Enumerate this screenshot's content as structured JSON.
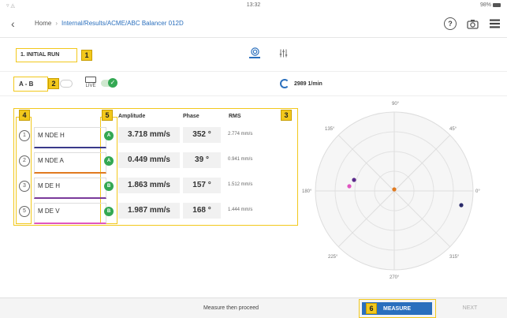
{
  "status": {
    "time": "13:32",
    "battery": "98%"
  },
  "header": {
    "crumb_home": "Home",
    "crumb_path": "Internal/Results/ACME/ABC Balancer 012D"
  },
  "run": {
    "title": "1. INITIAL RUN"
  },
  "plane": {
    "label": "A - B",
    "live": "LIVE"
  },
  "rpm": {
    "value": "2989 1/min"
  },
  "badges": [
    "1",
    "2",
    "3",
    "4",
    "5",
    "6"
  ],
  "table": {
    "headers": {
      "amplitude": "Amplitude",
      "phase": "Phase",
      "rms": "RMS"
    },
    "rows": [
      {
        "num": "1",
        "name": "M NDE H",
        "plane": "A",
        "amplitude": "3.718 mm/s",
        "phase": "352 °",
        "rms": "2.774 mm/s",
        "color": "#3a3a8a"
      },
      {
        "num": "2",
        "name": "M NDE A",
        "plane": "A",
        "amplitude": "0.449 mm/s",
        "phase": "39 °",
        "rms": "0.941 mm/s",
        "color": "#e07a20"
      },
      {
        "num": "3",
        "name": "M DE H",
        "plane": "B",
        "amplitude": "1.863 mm/s",
        "phase": "157 °",
        "rms": "1.512 mm/s",
        "color": "#7a3a9a"
      },
      {
        "num": "5",
        "name": "M DE V",
        "plane": "B",
        "amplitude": "1.987 mm/s",
        "phase": "168 °",
        "rms": "1.444 mm/s",
        "color": "#e055c0"
      }
    ]
  },
  "polar": {
    "angle_labels": [
      "90°",
      "45°",
      "0°",
      "315°",
      "270°",
      "225°",
      "180°",
      "135°"
    ]
  },
  "footer": {
    "message": "Measure then proceed",
    "measure_label": "MEASURE",
    "next_label": "NEXT"
  },
  "colors": {
    "accent": "#2a6fbd",
    "badge": "#f2c81c",
    "ok": "#34a853"
  }
}
